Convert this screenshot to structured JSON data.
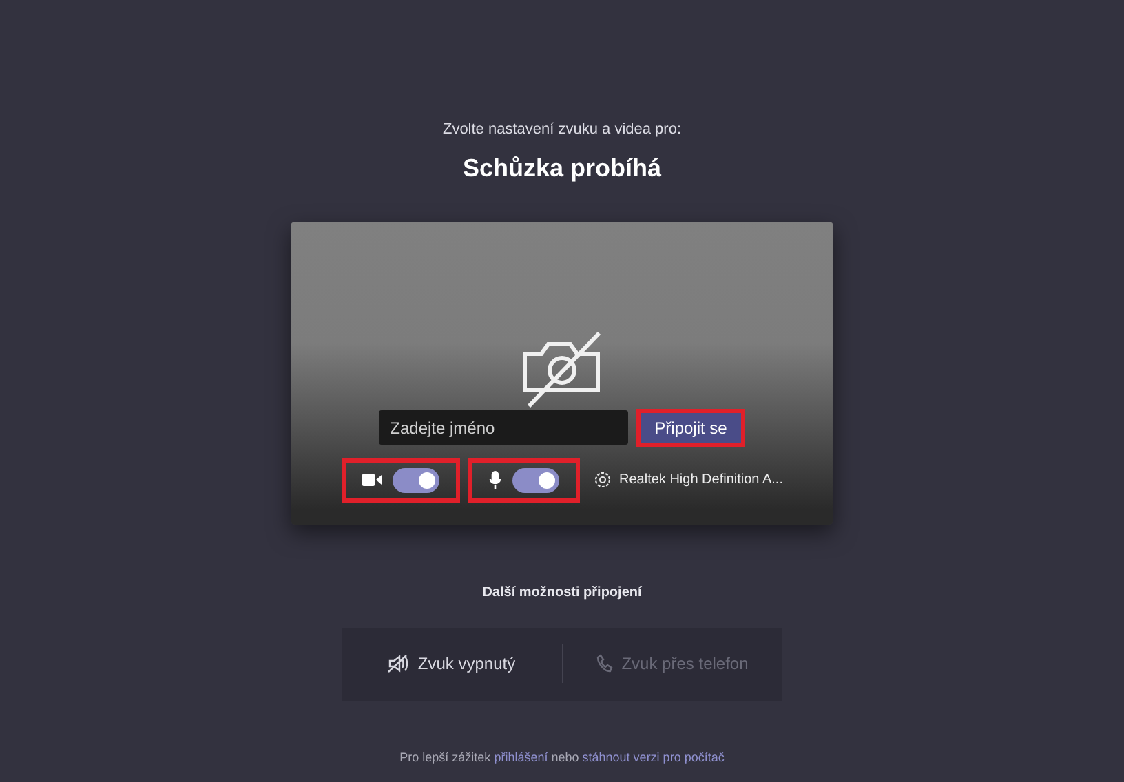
{
  "subtitle": "Zvolte nastavení zvuku a videa pro:",
  "title": "Schůzka probíhá",
  "preview": {
    "name_field": {
      "placeholder": "Zadejte jméno"
    },
    "join_button": {
      "label": "Připojit se",
      "highlighted": true
    },
    "camera_toggle": {
      "on": true,
      "highlighted": true
    },
    "mic_toggle": {
      "on": true,
      "highlighted": true
    },
    "audio_device": "Realtek High Definition A..."
  },
  "more_options": {
    "heading": "Další možnosti připojení",
    "options": [
      {
        "kind": "audio-off",
        "label": "Zvuk vypnutý",
        "disabled": false
      },
      {
        "kind": "phone",
        "label": "Zvuk přes telefon",
        "disabled": true
      }
    ]
  },
  "footer": {
    "text_1": "Pro lepší zážitek",
    "link_1": "přihlášení",
    "text_2": "nebo",
    "link_2": "stáhnout verzi pro počítač"
  }
}
